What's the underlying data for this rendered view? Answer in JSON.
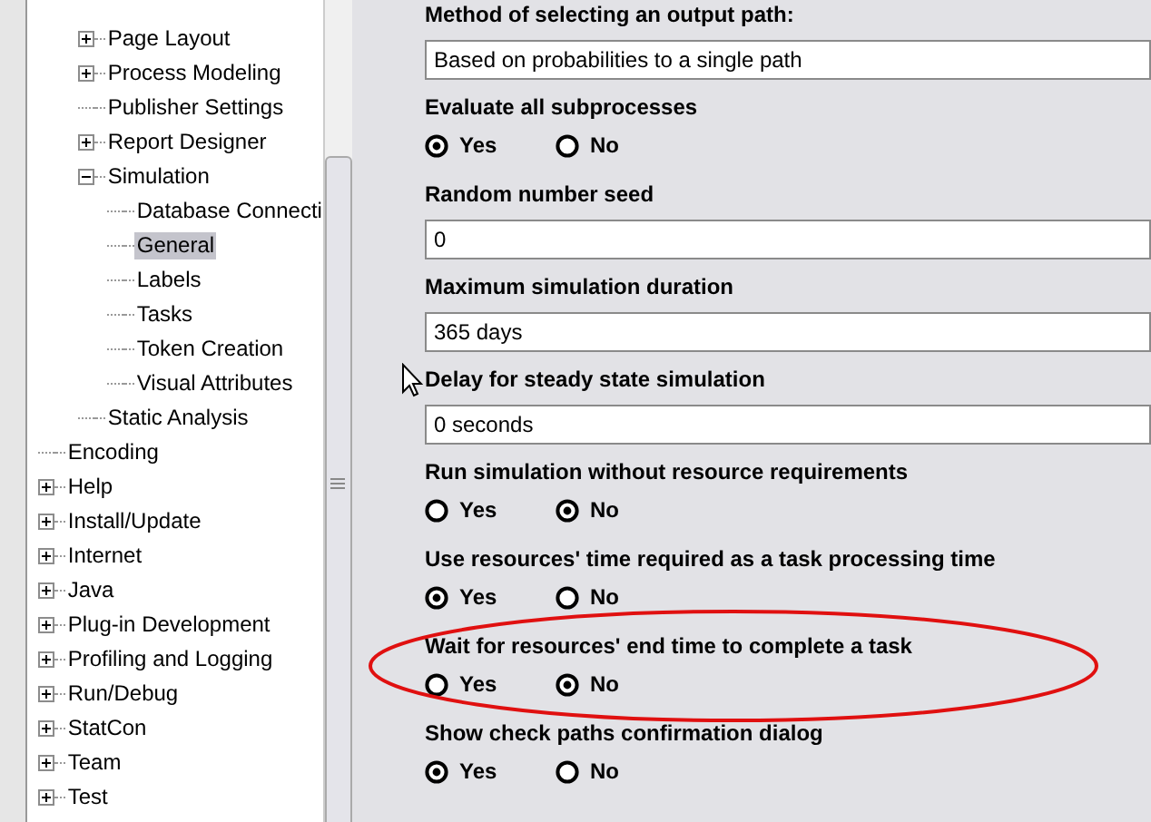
{
  "tree": {
    "items": [
      {
        "label": "Page Layout",
        "expanded": false
      },
      {
        "label": "Process Modeling",
        "expanded": false
      },
      {
        "label": "Publisher Settings"
      },
      {
        "label": "Report Designer",
        "expanded": false
      },
      {
        "label": "Simulation",
        "expanded": true,
        "children": [
          {
            "label": "Database Connecti",
            "selected": false
          },
          {
            "label": "General",
            "selected": true
          },
          {
            "label": "Labels",
            "selected": false
          },
          {
            "label": "Tasks",
            "selected": false
          },
          {
            "label": "Token Creation",
            "selected": false
          },
          {
            "label": "Visual Attributes",
            "selected": false
          }
        ]
      },
      {
        "label": "Static Analysis"
      }
    ],
    "roots": [
      {
        "label": "Encoding"
      },
      {
        "label": "Help",
        "expanded": false
      },
      {
        "label": "Install/Update",
        "expanded": false
      },
      {
        "label": "Internet",
        "expanded": false
      },
      {
        "label": "Java",
        "expanded": false
      },
      {
        "label": "Plug-in Development",
        "expanded": false
      },
      {
        "label": "Profiling and Logging",
        "expanded": false
      },
      {
        "label": "Run/Debug",
        "expanded": false
      },
      {
        "label": "StatCon",
        "expanded": false
      },
      {
        "label": "Team",
        "expanded": false
      },
      {
        "label": "Test",
        "expanded": false
      }
    ]
  },
  "settings": [
    {
      "kind": "field",
      "label": "Method of selecting an output path:",
      "value": "Based on probabilities to a single path"
    },
    {
      "kind": "radio",
      "label": "Evaluate all subprocesses",
      "options": [
        {
          "label": "Yes",
          "selected": true
        },
        {
          "label": "No",
          "selected": false
        }
      ]
    },
    {
      "kind": "field",
      "label": "Random number seed",
      "value": "0"
    },
    {
      "kind": "field",
      "label": "Maximum simulation duration",
      "value": "365 days"
    },
    {
      "kind": "field",
      "label": "Delay for steady state simulation",
      "value": "0 seconds"
    },
    {
      "kind": "radio",
      "label": "Run simulation without resource requirements",
      "options": [
        {
          "label": "Yes",
          "selected": false
        },
        {
          "label": "No",
          "selected": true
        }
      ]
    },
    {
      "kind": "radio",
      "label": "Use resources' time required as a task processing time",
      "options": [
        {
          "label": "Yes",
          "selected": true
        },
        {
          "label": "No",
          "selected": false
        }
      ]
    },
    {
      "kind": "radio",
      "label": "Wait for resources' end time to complete a task",
      "options": [
        {
          "label": "Yes",
          "selected": false
        },
        {
          "label": "No",
          "selected": true
        }
      ]
    },
    {
      "kind": "radio",
      "label": "Show check paths confirmation dialog",
      "options": [
        {
          "label": "Yes",
          "selected": true
        },
        {
          "label": "No",
          "selected": false
        }
      ]
    }
  ]
}
